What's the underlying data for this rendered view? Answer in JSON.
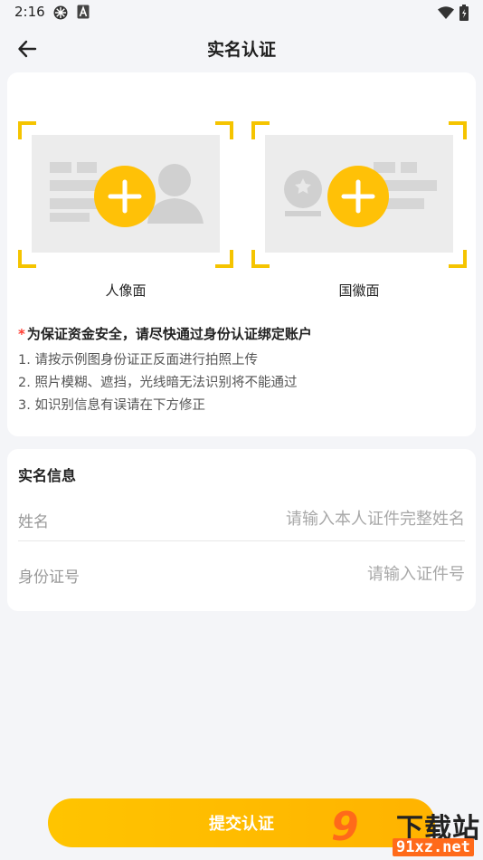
{
  "status_bar": {
    "time": "2:16",
    "icons": [
      "sync-icon",
      "a-icon",
      "wifi-icon",
      "battery-icon"
    ]
  },
  "header": {
    "title": "实名认证",
    "back_icon": "arrow-left-icon"
  },
  "upload": {
    "portrait_label": "人像面",
    "emblem_label": "国徽面",
    "accent_color": "#ffc107",
    "notice_star": "*",
    "notice": "为保证资金安全，请尽快通过身份认证绑定账户",
    "tips": [
      "1. 请按示例图身份证正反面进行拍照上传",
      "2. 照片模糊、遮挡，光线暗无法识别将不能通过",
      "3. 如识别信息有误请在下方修正"
    ]
  },
  "info": {
    "title": "实名信息",
    "name_label": "姓名",
    "name_placeholder": "请输入本人证件完整姓名",
    "id_label": "身份证号",
    "id_placeholder": "请输入证件号"
  },
  "submit_label": "提交认证",
  "watermark": {
    "number": "9",
    "name": "下载站",
    "url": "91xz.net"
  }
}
